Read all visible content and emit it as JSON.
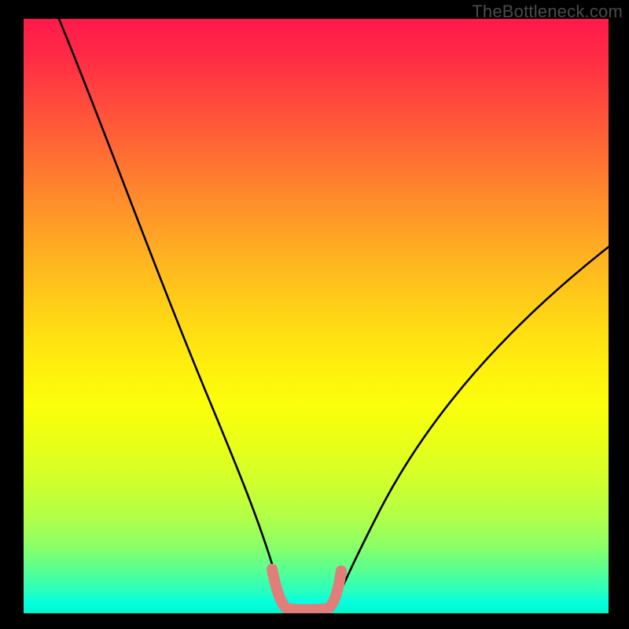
{
  "watermark": "TheBottleneck.com",
  "colors": {
    "background": "#000000",
    "curve_stroke": "#000000",
    "accent_stroke": "#e27e7a",
    "gradient_top": "#ff1a4b",
    "gradient_bottom": "#00f7c8"
  },
  "chart_data": {
    "type": "line",
    "title": "",
    "xlabel": "",
    "ylabel": "",
    "xlim": [
      0,
      100
    ],
    "ylim": [
      0,
      100
    ],
    "grid": false,
    "series": [
      {
        "name": "left_curve",
        "x": [
          6,
          10,
          14,
          18,
          22,
          26,
          30,
          33,
          36,
          38,
          40,
          41.5,
          43,
          44
        ],
        "y": [
          100,
          88,
          76,
          64,
          52,
          41,
          31,
          23,
          16,
          11,
          7,
          4.5,
          2.5,
          1.5
        ]
      },
      {
        "name": "right_curve",
        "x": [
          52,
          54,
          56,
          59,
          63,
          68,
          74,
          81,
          89,
          100
        ],
        "y": [
          2,
          4,
          7,
          12,
          19,
          27,
          36,
          45,
          53,
          62
        ]
      },
      {
        "name": "valley_floor_accent",
        "x": [
          42,
          44,
          46,
          49,
          51,
          52.5,
          53.5
        ],
        "y": [
          6,
          2,
          1,
          1,
          1.2,
          2.5,
          6
        ]
      }
    ],
    "annotations": []
  }
}
